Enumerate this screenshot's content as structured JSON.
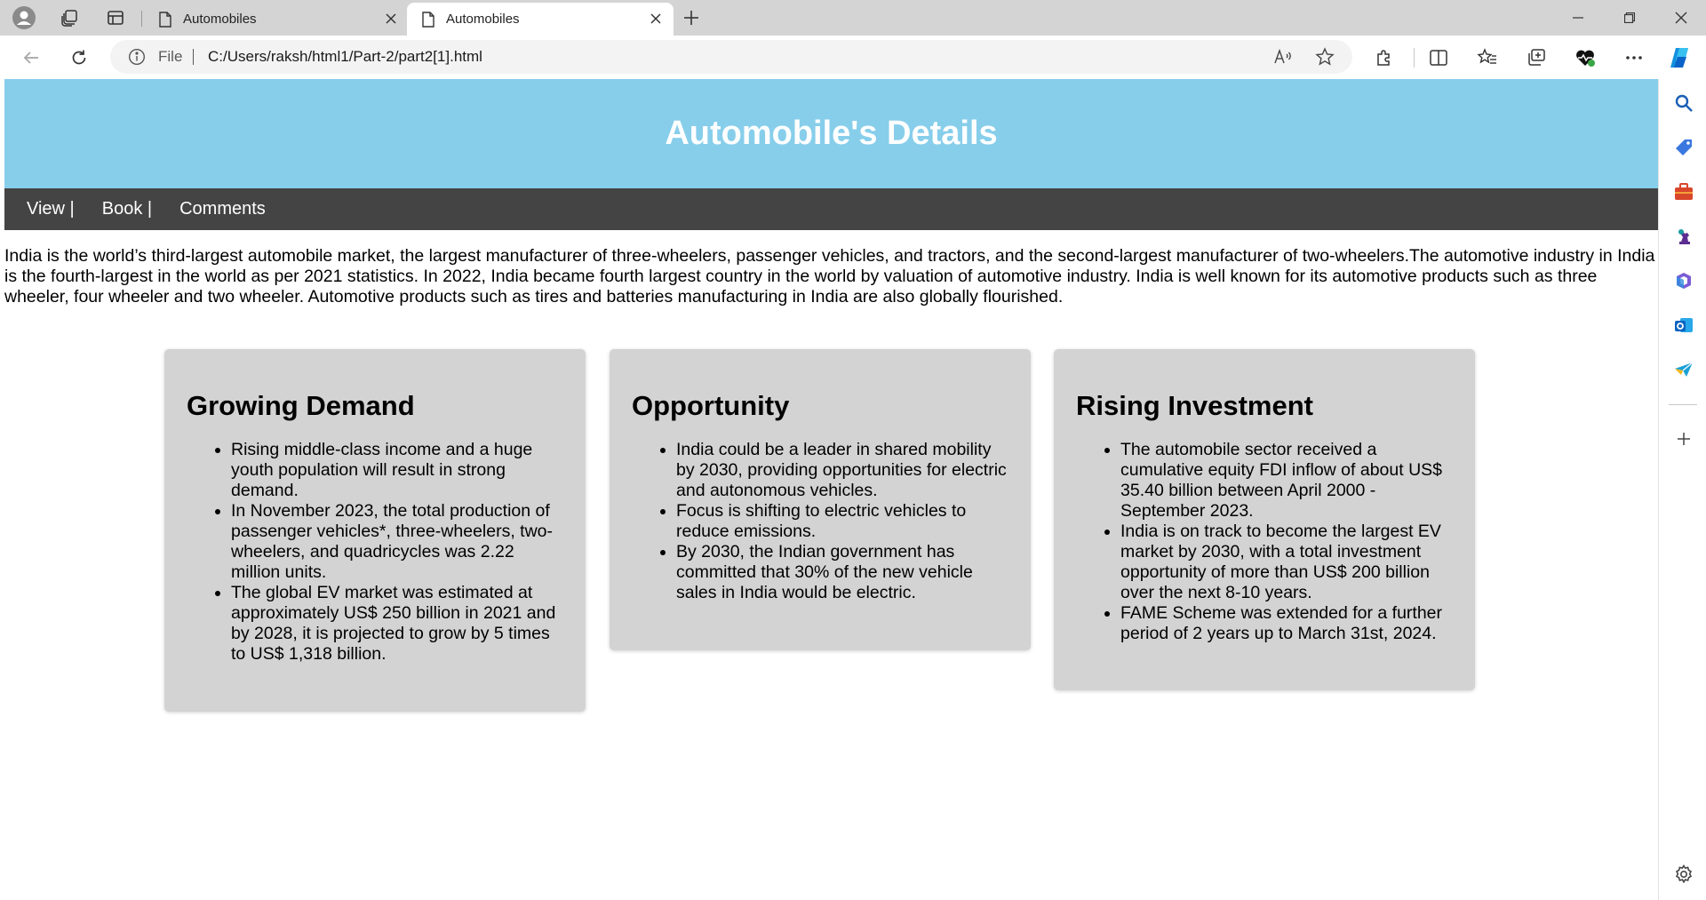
{
  "browser": {
    "tabs": [
      {
        "title": "Automobiles",
        "active": false
      },
      {
        "title": "Automobiles",
        "active": true
      }
    ],
    "address": {
      "scheme_label": "File",
      "url": "C:/Users/raksh/html1/Part-2/part2[1].html"
    },
    "icons": {
      "profile": "profile-icon",
      "workspaces": "workspaces-icon",
      "vertical_tabs": "vertical-tabs-icon",
      "read_aloud": "read-aloud-icon",
      "favorite": "star-icon",
      "extensions": "extensions-icon",
      "split_screen": "split-screen-icon",
      "favorites": "favorites-icon",
      "collections": "collections-icon",
      "browser_essentials": "heart-pulse-icon",
      "more": "more-icon",
      "copilot": "copilot-icon"
    },
    "sidebar_icons": [
      "search-icon",
      "shopping-tag-icon",
      "tools-briefcase-icon",
      "games-icon",
      "microsoft-365-icon",
      "outlook-icon",
      "drop-icon",
      "add-icon",
      "settings-icon"
    ],
    "colors": {
      "tabbar": "#d4d4d4",
      "accent_blue": "#0067c0"
    }
  },
  "page": {
    "header_title": "Automobile's Details",
    "header_color": "#87ceeb",
    "nav_color": "#444444",
    "nav": [
      "View |",
      "Book |",
      "Comments"
    ],
    "intro": "India is the world’s third-largest automobile market, the largest manufacturer of three-wheelers, passenger vehicles, and tractors, and the second-largest manufacturer of two-wheelers.The automotive industry in India is the fourth-largest in the world as per 2021 statistics. In 2022, India became fourth largest country in the world by valuation of automotive industry. India is well known for its automotive products such as three wheeler, four wheeler and two wheeler. Automotive products such as tires and batteries manufacturing in India are also globally flourished.",
    "cards": [
      {
        "title": "Growing Demand",
        "items": [
          "Rising middle-class income and a huge youth population will result in strong demand.",
          "In November 2023, the total production of passenger vehicles*, three-wheelers, two-wheelers, and quadricycles was 2.22 million units.",
          "The global EV market was estimated at approximately US$ 250 billion in 2021 and by 2028, it is projected to grow by 5 times to US$ 1,318 billion."
        ]
      },
      {
        "title": "Opportunity",
        "items": [
          "India could be a leader in shared mobility by 2030, providing opportunities for electric and autonomous vehicles.",
          "Focus is shifting to electric vehicles to reduce emissions.",
          "By 2030, the Indian government has committed that 30% of the new vehicle sales in India would be electric."
        ]
      },
      {
        "title": "Rising Investment",
        "items": [
          "The automobile sector received a cumulative equity FDI inflow of about US$ 35.40 billion between April 2000 - September 2023.",
          "India is on track to become the largest EV market by 2030, with a total investment opportunity of more than US$ 200 billion over the next 8-10 years.",
          "FAME Scheme was extended for a further period of 2 years up to March 31st, 2024."
        ]
      }
    ]
  }
}
